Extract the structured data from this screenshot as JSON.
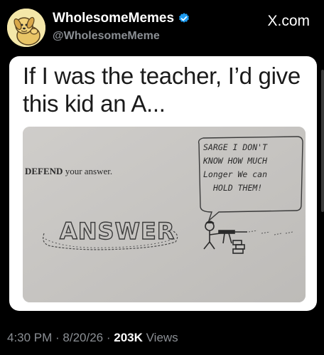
{
  "header": {
    "display_name": "WholesomeMemes",
    "handle": "@WholesomeMeme",
    "site": "X.com",
    "avatar_icon": "dog-avatar-icon",
    "verified_icon": "verified-badge-icon",
    "verified_color": "#1d9bf0"
  },
  "post": {
    "caption": "If I was the teacher, I’d give this kid an A...",
    "image": {
      "question_bold": "DEFEND",
      "question_rest": " your answer.",
      "drawn_word": "ANSWER",
      "speech_bubble_lines": [
        "SARGE I DON'T",
        "KNOW HOW MUCH",
        "Longer We can",
        "HOLD THEM!"
      ]
    }
  },
  "footer": {
    "time": "4:30 PM",
    "sep1": " · ",
    "date": "8/20/26",
    "sep2": " · ",
    "views_count": "203K",
    "views_label": " Views"
  },
  "colors": {
    "background": "#000000",
    "card": "#ffffff",
    "muted": "#8b8f94"
  }
}
